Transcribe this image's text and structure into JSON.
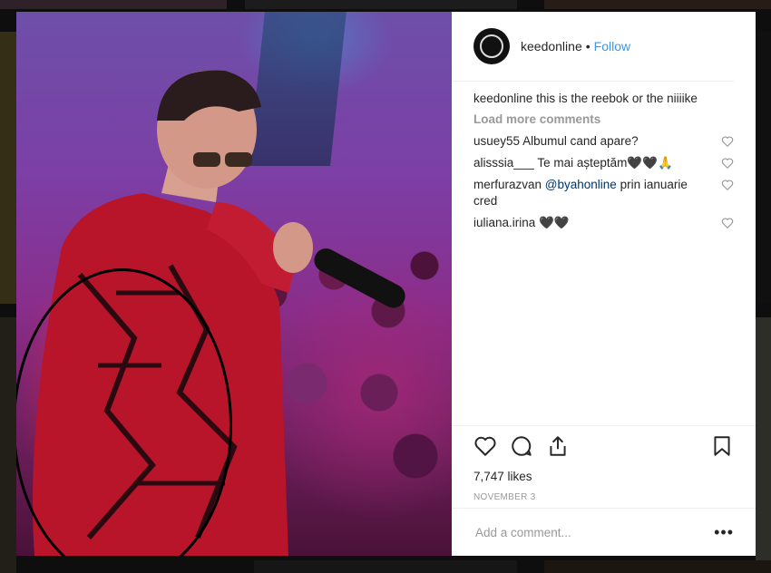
{
  "post": {
    "username": "keedonline",
    "separator": "•",
    "follow_label": "Follow",
    "caption_user": "keedonline",
    "caption_text": "this is the reebok or the niiiike",
    "load_more_label": "Load more comments",
    "comments": [
      {
        "user": "usuey55",
        "text": "Albumul cand apare?",
        "mention": ""
      },
      {
        "user": "alisssia___",
        "text": "Te mai așteptăm🖤🖤🙏",
        "mention": ""
      },
      {
        "user": "merfurazvan",
        "mention": "@byahonline",
        "text": "prin ianuarie cred"
      },
      {
        "user": "iuliana.irina",
        "text": "🖤🖤",
        "mention": ""
      }
    ],
    "likes": "7,747 likes",
    "date": "NOVEMBER 3",
    "comment_placeholder": "Add a comment...",
    "more_options": "•••"
  },
  "icons": {
    "avatar": "profile-avatar",
    "like": "heart-icon",
    "comment": "comment-bubble-icon",
    "share": "share-icon",
    "save": "bookmark-icon",
    "comment_like": "small-heart-icon"
  },
  "colors": {
    "link": "#3897f0",
    "mention": "#003569",
    "muted": "#999999"
  }
}
